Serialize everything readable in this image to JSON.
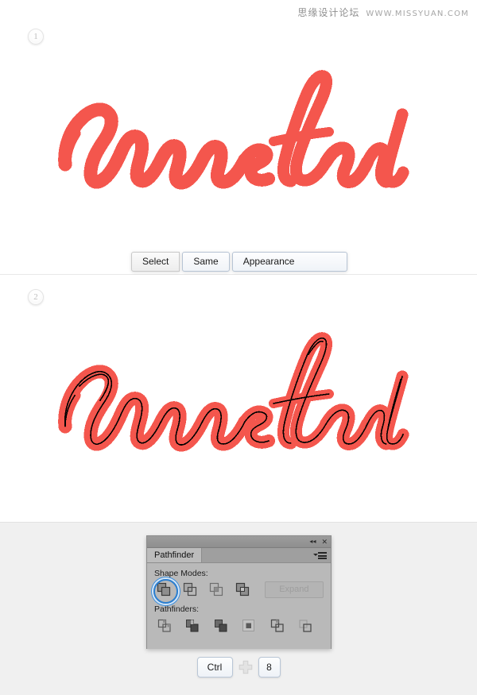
{
  "watermark": {
    "cn": "思缘设计论坛",
    "en": "WWW.MISSYUAN.COM"
  },
  "steps": [
    {
      "number": "1",
      "name": "step-one"
    },
    {
      "number": "2",
      "name": "step-two"
    }
  ],
  "artwork": {
    "word": "mustard",
    "fill_color": "#f4564d",
    "outline_color": "#000000",
    "step1_caption": "mustard lettering filled red",
    "step2_caption": "mustard lettering with selected black paths"
  },
  "menu_strip": {
    "items": [
      {
        "label": "Select",
        "name": "menu-select"
      },
      {
        "label": "Same",
        "name": "menu-same"
      },
      {
        "label": "Appearance",
        "name": "menu-appearance"
      }
    ]
  },
  "panel": {
    "title": "Pathfinder",
    "collapse_icon": "◄◄",
    "close_icon": "✕",
    "menu_icon": "panel-flyout-menu",
    "shape_modes_label": "Shape Modes:",
    "pathfinders_label": "Pathfinders:",
    "expand_label": "Expand",
    "expand_disabled": true,
    "shape_modes": [
      {
        "name": "unite",
        "selected": true
      },
      {
        "name": "minus-front",
        "selected": false
      },
      {
        "name": "intersect",
        "selected": false
      },
      {
        "name": "exclude",
        "selected": false
      }
    ],
    "pathfinders": [
      {
        "name": "divide"
      },
      {
        "name": "trim"
      },
      {
        "name": "merge"
      },
      {
        "name": "crop"
      },
      {
        "name": "outline"
      },
      {
        "name": "minus-back"
      }
    ]
  },
  "shortcut": {
    "key1": "Ctrl",
    "separator": "plus",
    "key2": "8"
  },
  "colors": {
    "page_background": "#f0f0f0",
    "canvas": "#ffffff",
    "accent_red": "#f4564d",
    "panel_gray": "#b9b9b9",
    "selection_blue": "#2c7fd0"
  }
}
